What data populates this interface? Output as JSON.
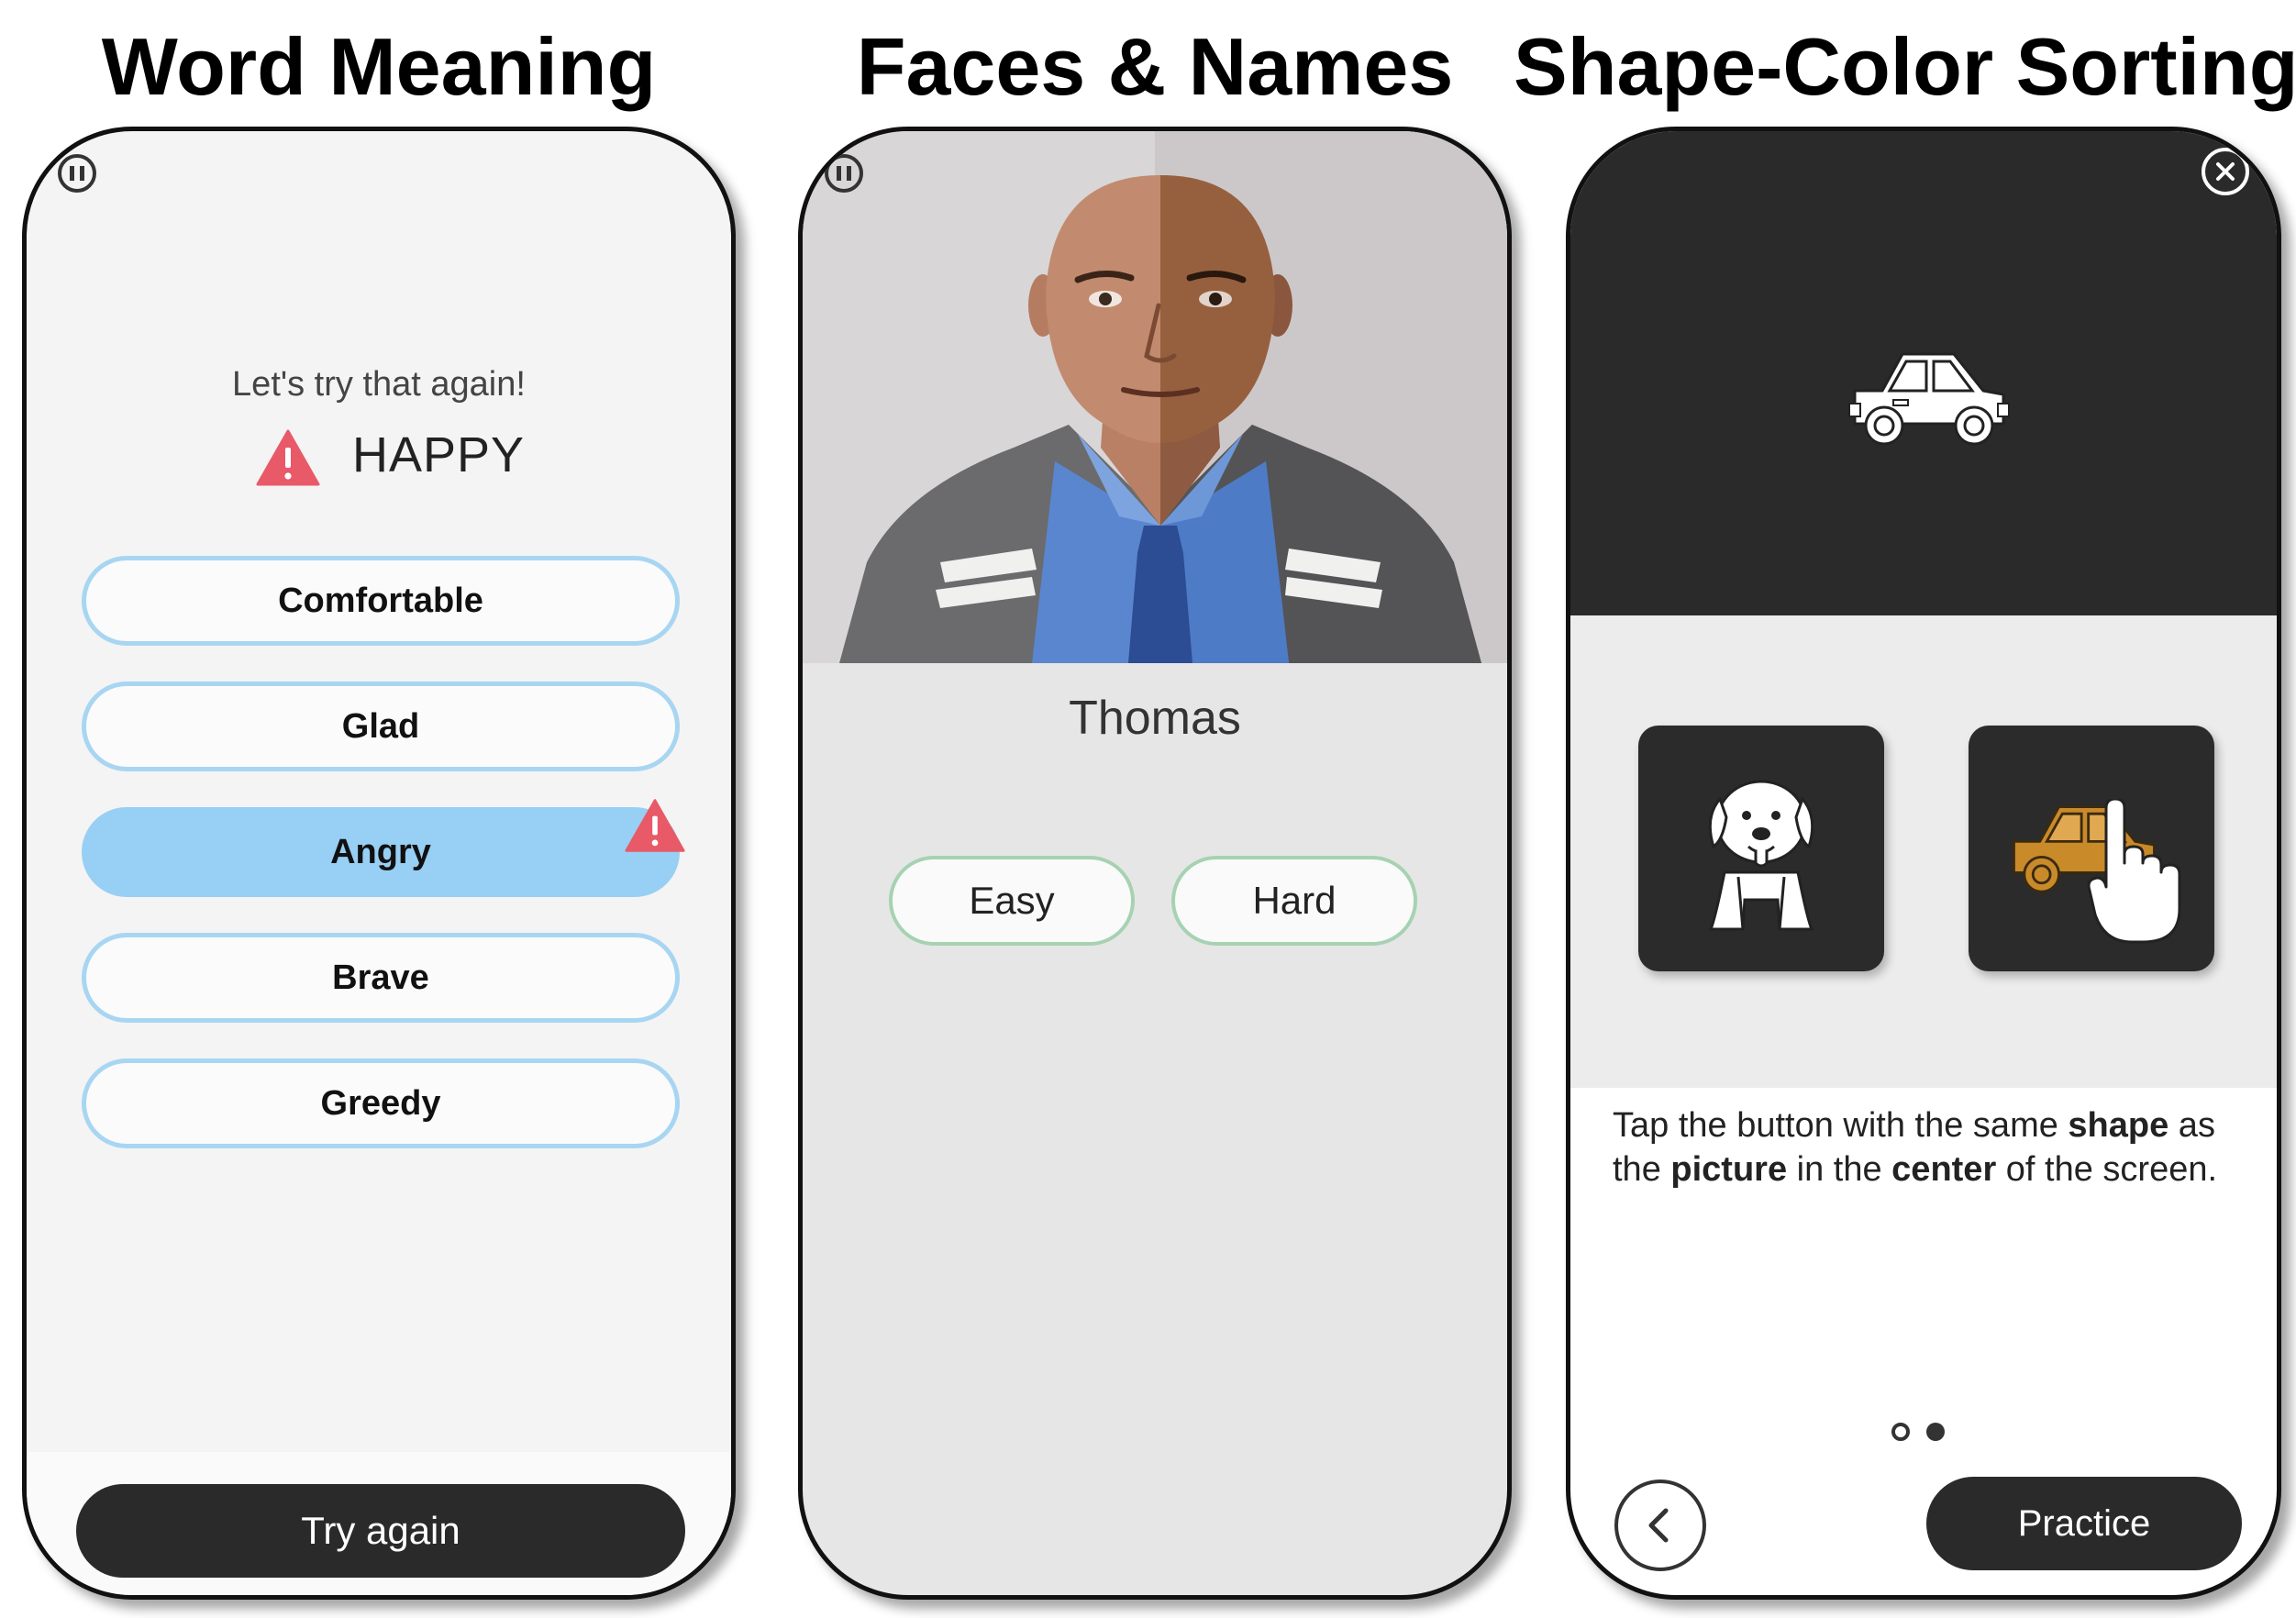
{
  "panels": {
    "word_meaning": {
      "heading": "Word Meaning",
      "feedback": "Let's try that again!",
      "target_word": "HAPPY",
      "options": [
        "Comfortable",
        "Glad",
        "Angry",
        "Brave",
        "Greedy"
      ],
      "selected_option": "Angry",
      "try_again_label": "Try again",
      "colors": {
        "option_border": "#a8d6f2",
        "selected_fill": "#98cff4",
        "warning": "#e85a68",
        "dark_button": "#2a2a2a"
      }
    },
    "faces_names": {
      "heading": "Faces & Names",
      "person_name": "Thomas",
      "easy_label": "Easy",
      "hard_label": "Hard",
      "colors": {
        "difficulty_border": "#a6d2b2"
      }
    },
    "shape_color": {
      "heading": "Shape-Color Sorting",
      "instruction": {
        "p1": "Tap the button with the same ",
        "b1": "shape",
        "p2": " as the ",
        "b2": "picture",
        "p3": " in the ",
        "b3": "center",
        "p4": " of the screen."
      },
      "practice_label": "Practice",
      "page_indicator": {
        "current": 2,
        "total": 2
      },
      "center_picture": "car-outline-icon",
      "choices": [
        "dog-icon",
        "car-orange-icon"
      ],
      "colors": {
        "dark_panel": "#2a2a2a",
        "car_fill": "#c98a2a"
      }
    }
  }
}
